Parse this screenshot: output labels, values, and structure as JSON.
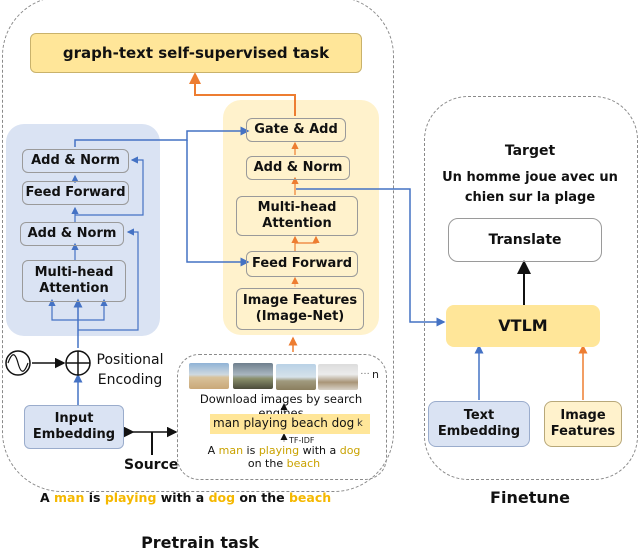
{
  "colors": {
    "blue_fill": "#dae3f3",
    "yellow_fill": "#fff2cc",
    "yellow_strong": "#ffe699",
    "blue_line": "#4472c4",
    "orange_line": "#ed7d31",
    "highlight_word": "#f5b800"
  },
  "pretrain": {
    "caption": "Pretrain task",
    "self_supervised_task": "graph-text self-supervised task",
    "text_encoder": {
      "add_norm_top": "Add & Norm",
      "feed_forward": "Feed Forward",
      "add_norm_bottom": "Add & Norm",
      "attention_line1": "Multi-head",
      "attention_line2": "Attention"
    },
    "positional_encoding": {
      "line1": "Positional",
      "line2": "Encoding",
      "wave_icon": "sine-wave-icon",
      "add_icon": "circled-plus-icon"
    },
    "input_embedding": {
      "line1": "Input",
      "line2": "Embedding"
    },
    "source_label": "Source",
    "image_encoder": {
      "gate_add": "Gate & Add",
      "add_norm": "Add & Norm",
      "attention_line1": "Multi-head",
      "attention_line2": "Attention",
      "feed_forward": "Feed Forward",
      "image_features_line1": "Image Features",
      "image_features_line2": "(Image-Net)"
    },
    "retrieval": {
      "thumbnail_count_label": "n",
      "ellipsis": "…",
      "download_caption": "Download images by search engines",
      "keywords": "man playing beach dog",
      "keywords_count_label": "k",
      "tfidf_label": "TF-IDF",
      "sentence_parts": [
        {
          "text": "A ",
          "highlight": false
        },
        {
          "text": "man",
          "highlight": true
        },
        {
          "text": " is ",
          "highlight": false
        },
        {
          "text": "playing",
          "highlight": true
        },
        {
          "text": " with a ",
          "highlight": false
        },
        {
          "text": "dog",
          "highlight": true
        }
      ],
      "sentence_line2_parts": [
        {
          "text": "on the ",
          "highlight": false
        },
        {
          "text": "beach",
          "highlight": true
        }
      ]
    },
    "source_sentence_parts": [
      {
        "text": "A ",
        "highlight": false
      },
      {
        "text": "man",
        "highlight": true
      },
      {
        "text": " is ",
        "highlight": false
      },
      {
        "text": "playing",
        "highlight": true
      },
      {
        "text": " with a ",
        "highlight": false
      },
      {
        "text": "dog",
        "highlight": true
      },
      {
        "text": " on the ",
        "highlight": false
      },
      {
        "text": "beach",
        "highlight": true
      }
    ]
  },
  "finetune": {
    "caption": "Finetune",
    "target_label": "Target",
    "target_line1": "Un homme joue avec un",
    "target_line2": "chien sur la plage",
    "translate": "Translate",
    "vtlm": "VTLM",
    "text_embedding_line1": "Text",
    "text_embedding_line2": "Embedding",
    "image_features_line1": "Image",
    "image_features_line2": "Features"
  }
}
